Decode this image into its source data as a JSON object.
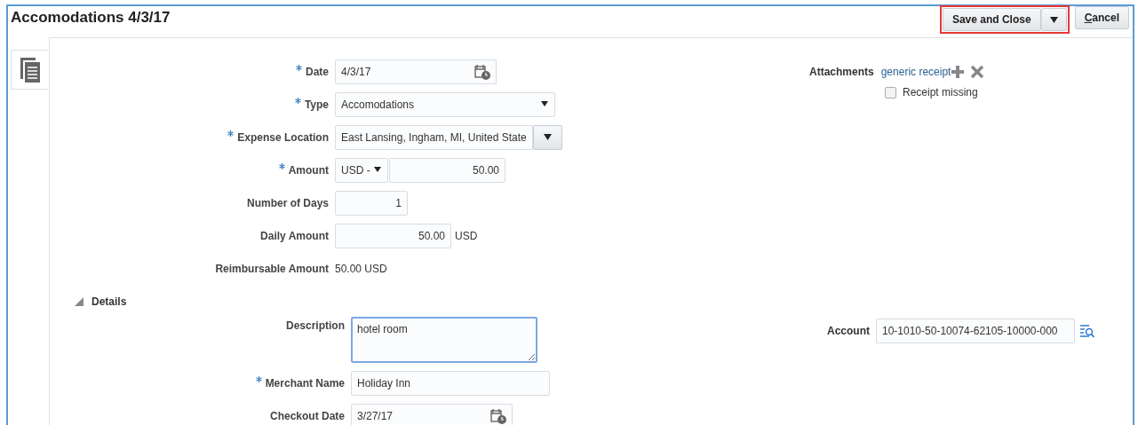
{
  "title": "Accomodations 4/3/17",
  "buttons": {
    "save": {
      "label": "Save and Close",
      "highlighted": true
    },
    "cancel": {
      "label": "Cancel"
    }
  },
  "fields": [
    {
      "kind": "date",
      "label": "Date",
      "required": true,
      "value": "4/3/17"
    },
    {
      "kind": "select",
      "label": "Type",
      "required": true,
      "value": "Accomodations"
    },
    {
      "kind": "combo",
      "label": "Expense Location",
      "required": true,
      "value": "East Lansing, Ingham, MI, United State"
    },
    {
      "kind": "currency",
      "label": "Amount",
      "required": true,
      "currency": "USD -",
      "value": "50.00"
    },
    {
      "kind": "number",
      "label": "Number of Days",
      "required": false,
      "value": "1"
    },
    {
      "kind": "number",
      "label": "Daily Amount",
      "required": false,
      "value": "50.00",
      "unit": "USD"
    },
    {
      "kind": "readonly",
      "label": "Reimbursable Amount",
      "required": false,
      "value": "50.00 USD"
    }
  ],
  "attachments": {
    "label": "Attachments",
    "file": "generic receipt"
  },
  "receipt_missing": {
    "label": "Receipt missing",
    "checked": false
  },
  "details": {
    "label": "Details",
    "expanded": true,
    "fields": [
      {
        "kind": "textarea",
        "label": "Description",
        "required": false,
        "value": "hotel room"
      },
      {
        "kind": "text",
        "label": "Merchant Name",
        "required": true,
        "value": "Holiday Inn"
      },
      {
        "kind": "date",
        "label": "Checkout Date",
        "required": false,
        "value": "3/27/17"
      }
    ],
    "account": {
      "label": "Account",
      "value": "10-1010-50-10074-62105-10000-000"
    }
  }
}
